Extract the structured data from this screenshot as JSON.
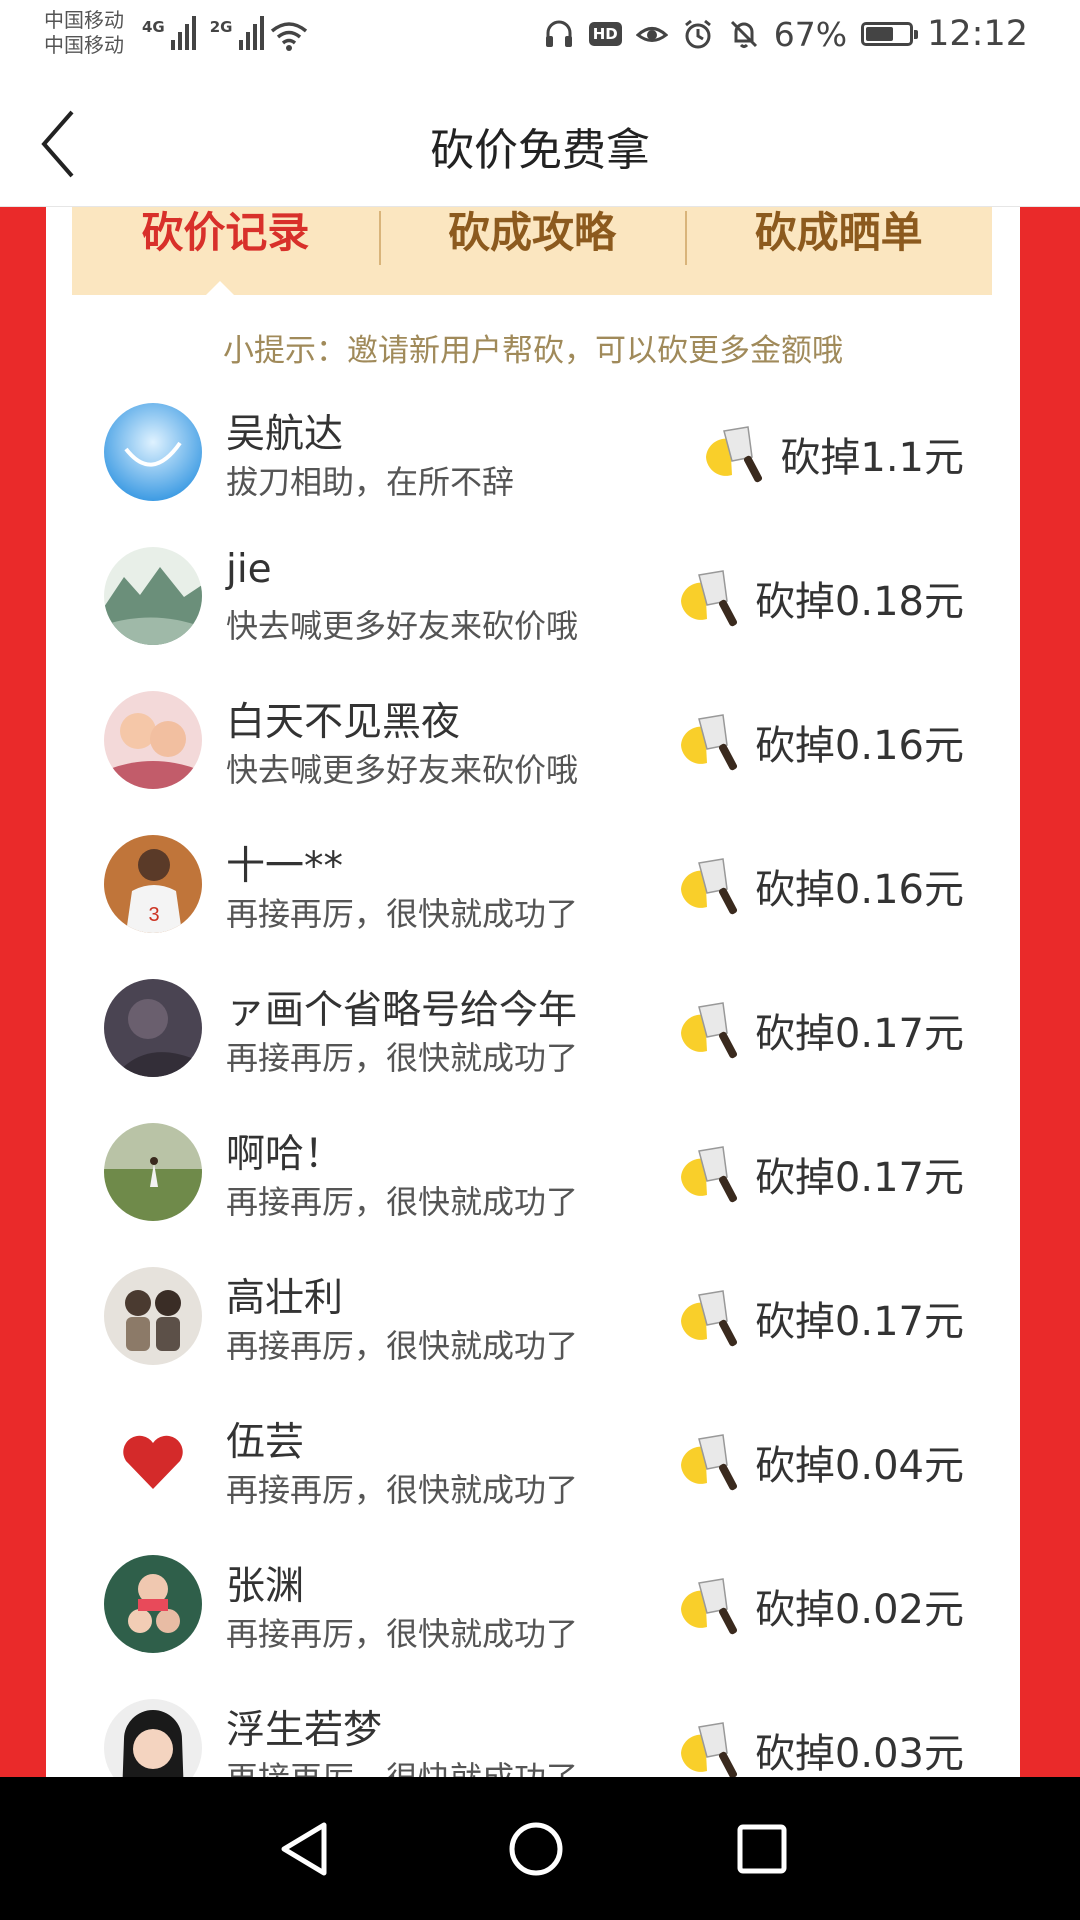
{
  "status_bar": {
    "carrier_1": "中国移动",
    "carrier_2": "中国移动",
    "net_1": "4G",
    "net_2": "2G",
    "hd": "HD",
    "battery_percent": "67%",
    "battery_level": 0.67,
    "time": "12:12"
  },
  "nav": {
    "title": "砍价免费拿",
    "back_icon": "chevron-left-icon"
  },
  "tabs": [
    {
      "label": "砍价记录",
      "active": true
    },
    {
      "label": "砍成攻略",
      "active": false
    },
    {
      "label": "砍成晒单",
      "active": false
    }
  ],
  "tip": "小提示：邀请新用户帮砍，可以砍更多金额哦",
  "records": [
    {
      "name": "吴航达",
      "message": "拔刀相助，在所不辞",
      "amount": "砍掉1.1元",
      "avatar": "sky-avatar"
    },
    {
      "name": "jie",
      "message": "快去喊更多好友来砍价哦",
      "amount": "砍掉0.18元",
      "avatar": "landscape-avatar"
    },
    {
      "name": "白天不见黑夜",
      "message": "快去喊更多好友来砍价哦",
      "amount": "砍掉0.16元",
      "avatar": "kids-avatar"
    },
    {
      "name": "十一**",
      "message": "再接再厉，很快就成功了",
      "amount": "砍掉0.16元",
      "avatar": "basketball-avatar"
    },
    {
      "name": "ァ画个省略号给今年",
      "message": "再接再厉，很快就成功了",
      "amount": "砍掉0.17元",
      "avatar": "dark-avatar"
    },
    {
      "name": "啊哈！",
      "message": "再接再厉，很快就成功了",
      "amount": "砍掉0.17元",
      "avatar": "field-avatar"
    },
    {
      "name": "高壮利",
      "message": "再接再厉，很快就成功了",
      "amount": "砍掉0.17元",
      "avatar": "children-avatar"
    },
    {
      "name": "伍芸",
      "message": "再接再厉，很快就成功了",
      "amount": "砍掉0.04元",
      "avatar": "heart-avatar"
    },
    {
      "name": "张渊",
      "message": "再接再厉，很快就成功了",
      "amount": "砍掉0.02元",
      "avatar": "family-avatar"
    },
    {
      "name": "浮生若梦",
      "message": "再接再厉，很快就成功了",
      "amount": "砍掉0.03元",
      "avatar": "girl-avatar"
    }
  ],
  "colors": {
    "frame_red": "#ea2a2a",
    "tab_bg": "#fbe6c0",
    "active_tab": "#d8302a",
    "tab_text": "#8c5a1e",
    "tip_text": "#a08a5a"
  },
  "cut_icon": "cleaver-icon",
  "system_nav": {
    "back": "back-triangle-icon",
    "home": "home-circle-icon",
    "recents": "recents-square-icon"
  }
}
